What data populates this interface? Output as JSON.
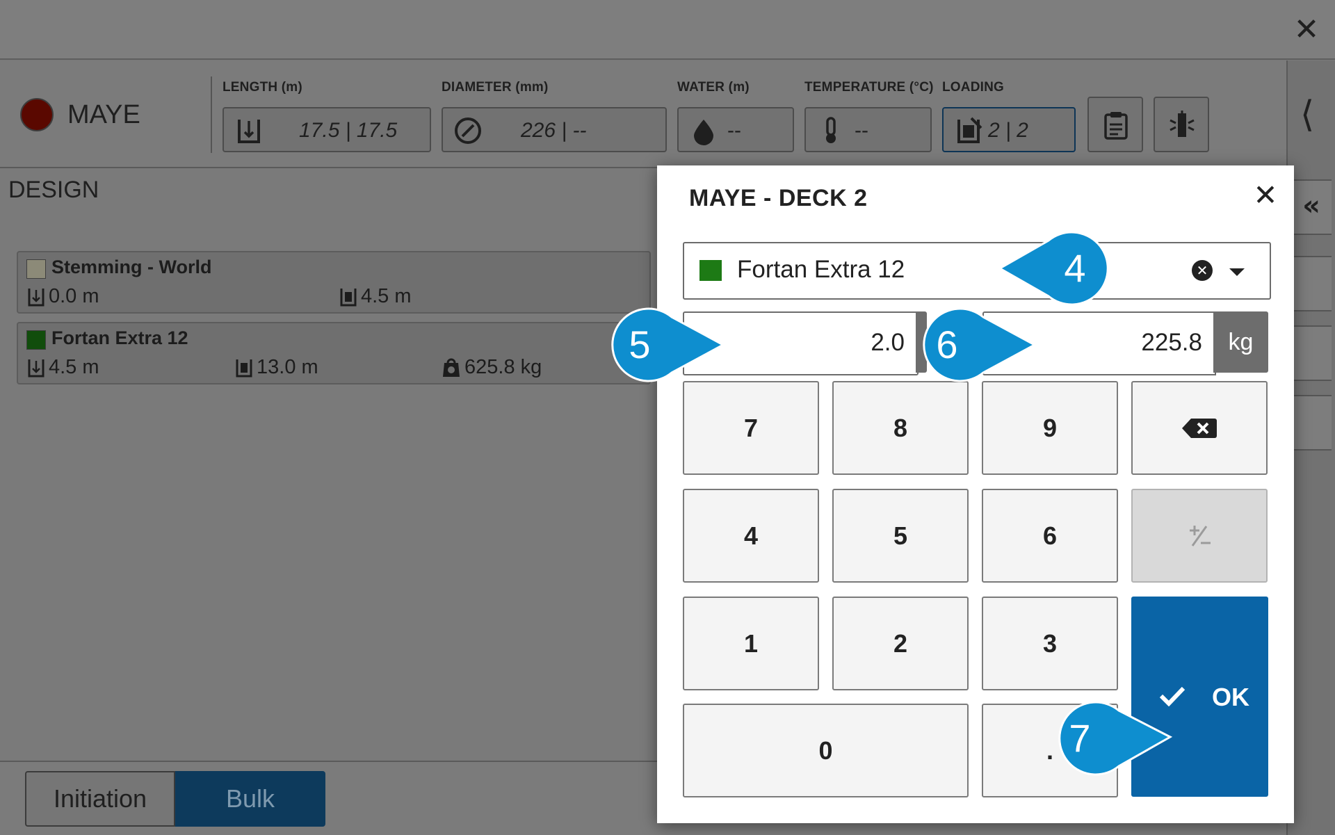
{
  "window": {
    "close_icon": "close-icon"
  },
  "device": {
    "name": "MAYE",
    "status_color": "#5a0800"
  },
  "metrics": [
    {
      "label": "LENGTH (m)",
      "value": "17.5 | 17.5",
      "icon": "length-icon"
    },
    {
      "label": "DIAMETER (mm)",
      "value": "226 | --",
      "icon": "diameter-icon"
    },
    {
      "label": "WATER (m)",
      "value": "--",
      "icon": "water-drop-icon"
    },
    {
      "label": "TEMPERATURE (°C)",
      "value": "--",
      "icon": "thermometer-icon"
    },
    {
      "label": "LOADING",
      "value": "2 | 2",
      "icon": "loading-icon"
    }
  ],
  "toolbar": {
    "clipboard_icon": "clipboard-icon",
    "detonator_icon": "detonator-icon"
  },
  "design": {
    "title": "DESIGN",
    "items": [
      {
        "name": "Stemming - World",
        "color": "#8c8a78",
        "top": "0.0 m",
        "bottom": "4.5 m"
      },
      {
        "name": "Fortan Extra 12",
        "color": "#114d0c",
        "top": "4.5 m",
        "bottom": "13.0 m",
        "weight": "625.8 kg"
      }
    ]
  },
  "modes": {
    "initiation": "Initiation",
    "bulk": "Bulk"
  },
  "dialog": {
    "title": "MAYE - DECK 2",
    "material": {
      "name": "Fortan Extra 12",
      "color": "#1d7a15"
    },
    "length_value": "2.0",
    "weight_value": "225.8",
    "weight_unit": "kg",
    "keypad": [
      "7",
      "8",
      "9",
      "4",
      "5",
      "6",
      "1",
      "2",
      "3",
      "0",
      "."
    ],
    "ok_label": "OK"
  },
  "callouts": [
    {
      "label": "4",
      "color": "#0e8ecf"
    },
    {
      "label": "5",
      "color": "#0e8ecf"
    },
    {
      "label": "6",
      "color": "#0e8ecf"
    },
    {
      "label": "7",
      "color": "#0e8ecf"
    }
  ]
}
